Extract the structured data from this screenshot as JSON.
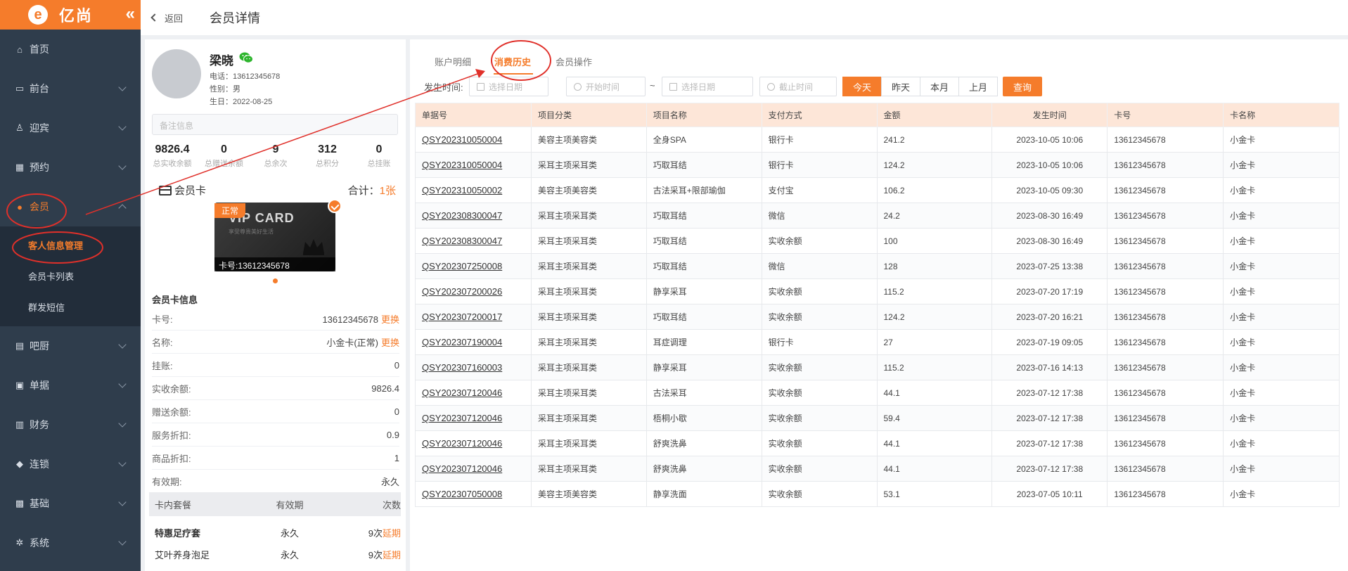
{
  "app": {
    "logo_mark": "e",
    "logo_text": "亿尚",
    "collapse_icon": "«"
  },
  "sidebar": {
    "items": [
      {
        "label": "首页",
        "icon": "home-icon"
      },
      {
        "label": "前台",
        "icon": "monitor-icon"
      },
      {
        "label": "迎宾",
        "icon": "welcome-icon"
      },
      {
        "label": "预约",
        "icon": "calendar-icon"
      },
      {
        "label": "会员",
        "icon": "user-icon"
      },
      {
        "label": "吧厨",
        "icon": "book-icon"
      },
      {
        "label": "单据",
        "icon": "document-icon"
      },
      {
        "label": "财务",
        "icon": "finance-icon"
      },
      {
        "label": "连锁",
        "icon": "chain-icon"
      },
      {
        "label": "基础",
        "icon": "base-icon"
      },
      {
        "label": "系统",
        "icon": "gear-icon"
      }
    ],
    "subitems": [
      {
        "label": "客人信息管理"
      },
      {
        "label": "会员卡列表"
      },
      {
        "label": "群发短信"
      }
    ],
    "accent": "#f57c2b"
  },
  "header": {
    "back_label": "返回",
    "title": "会员详情"
  },
  "member": {
    "name": "梁晓",
    "phone": "电话：13612345678",
    "gender": "性别：男",
    "birthday": "生日：2022-08-25",
    "note_placeholder": "备注信息",
    "stats": [
      {
        "value": "9826.4",
        "label": "总实收余额"
      },
      {
        "value": "0",
        "label": "总赠送余额"
      },
      {
        "value": "9",
        "label": "总余次"
      },
      {
        "value": "312",
        "label": "总积分"
      },
      {
        "value": "0",
        "label": "总挂账"
      }
    ],
    "card_section_label": "会员卡",
    "card_total_label": "合计：",
    "card_total_value": "1张",
    "card": {
      "status": "正常",
      "title": "VIP CARD",
      "subtitle": "享受尊贵美好生活",
      "card_no": "卡号:13612345678"
    },
    "card_info_title": "会员卡信息",
    "card_info": [
      {
        "label": "卡号:",
        "value": "13612345678",
        "action": "更换"
      },
      {
        "label": "名称:",
        "value": "小金卡(正常)",
        "action": "更换"
      },
      {
        "label": "挂账:",
        "value": "0",
        "action": ""
      },
      {
        "label": "实收余额:",
        "value": "9826.4",
        "action": ""
      },
      {
        "label": "赠送余额:",
        "value": "0",
        "action": ""
      },
      {
        "label": "服务折扣:",
        "value": "0.9",
        "action": ""
      },
      {
        "label": "商品折扣:",
        "value": "1",
        "action": ""
      },
      {
        "label": "有效期:",
        "value": "永久",
        "action": ""
      }
    ],
    "package_headers": [
      "卡内套餐",
      "有效期",
      "次数"
    ],
    "packages": [
      {
        "name": "特惠足疗套",
        "validity": "永久",
        "count": "9次",
        "action": "延期"
      },
      {
        "name": "艾叶养身泡足",
        "validity": "永久",
        "count": "9次",
        "action": "延期"
      }
    ]
  },
  "main": {
    "tabs": [
      {
        "label": "账户明细"
      },
      {
        "label": "消费历史"
      },
      {
        "label": "会员操作"
      }
    ],
    "filter": {
      "label": "发生时间:",
      "start_date_placeholder": "选择日期",
      "start_time_placeholder": "开始时间",
      "tilde": "~",
      "end_date_placeholder": "选择日期",
      "end_time_placeholder": "截止时间",
      "quick_buttons": [
        "今天",
        "昨天",
        "本月",
        "上月"
      ],
      "search_label": "查询"
    },
    "table": {
      "headers": [
        "单据号",
        "项目分类",
        "项目名称",
        "支付方式",
        "金额",
        "发生时间",
        "卡号",
        "卡名称"
      ],
      "rows": [
        [
          "QSY202310050004",
          "美容主项美容类",
          "全身SPA",
          "银行卡",
          "241.2",
          "2023-10-05 10:06",
          "13612345678",
          "小金卡"
        ],
        [
          "QSY202310050004",
          "采耳主项采耳类",
          "巧取耳结",
          "银行卡",
          "124.2",
          "2023-10-05 10:06",
          "13612345678",
          "小金卡"
        ],
        [
          "QSY202310050002",
          "美容主项美容类",
          "古法采耳+限部瑜伽",
          "支付宝",
          "106.2",
          "2023-10-05 09:30",
          "13612345678",
          "小金卡"
        ],
        [
          "QSY202308300047",
          "采耳主项采耳类",
          "巧取耳结",
          "微信",
          "24.2",
          "2023-08-30 16:49",
          "13612345678",
          "小金卡"
        ],
        [
          "QSY202308300047",
          "采耳主项采耳类",
          "巧取耳结",
          "实收余额",
          "100",
          "2023-08-30 16:49",
          "13612345678",
          "小金卡"
        ],
        [
          "QSY202307250008",
          "采耳主项采耳类",
          "巧取耳结",
          "微信",
          "128",
          "2023-07-25 13:38",
          "13612345678",
          "小金卡"
        ],
        [
          "QSY202307200026",
          "采耳主项采耳类",
          "静享采耳",
          "实收余额",
          "115.2",
          "2023-07-20 17:19",
          "13612345678",
          "小金卡"
        ],
        [
          "QSY202307200017",
          "采耳主项采耳类",
          "巧取耳结",
          "实收余额",
          "124.2",
          "2023-07-20 16:21",
          "13612345678",
          "小金卡"
        ],
        [
          "QSY202307190004",
          "采耳主项采耳类",
          "耳症调理",
          "银行卡",
          "27",
          "2023-07-19 09:05",
          "13612345678",
          "小金卡"
        ],
        [
          "QSY202307160003",
          "采耳主项采耳类",
          "静享采耳",
          "实收余额",
          "115.2",
          "2023-07-16 14:13",
          "13612345678",
          "小金卡"
        ],
        [
          "QSY202307120046",
          "采耳主项采耳类",
          "古法采耳",
          "实收余额",
          "44.1",
          "2023-07-12 17:38",
          "13612345678",
          "小金卡"
        ],
        [
          "QSY202307120046",
          "采耳主项采耳类",
          "梧桐小歇",
          "实收余额",
          "59.4",
          "2023-07-12 17:38",
          "13612345678",
          "小金卡"
        ],
        [
          "QSY202307120046",
          "采耳主项采耳类",
          "舒爽洗鼻",
          "实收余额",
          "44.1",
          "2023-07-12 17:38",
          "13612345678",
          "小金卡"
        ],
        [
          "QSY202307120046",
          "采耳主项采耳类",
          "舒爽洗鼻",
          "实收余额",
          "44.1",
          "2023-07-12 17:38",
          "13612345678",
          "小金卡"
        ],
        [
          "QSY202307050008",
          "美容主项美容类",
          "静享洗面",
          "实收余额",
          "53.1",
          "2023-07-05 10:11",
          "13612345678",
          "小金卡"
        ]
      ]
    }
  }
}
